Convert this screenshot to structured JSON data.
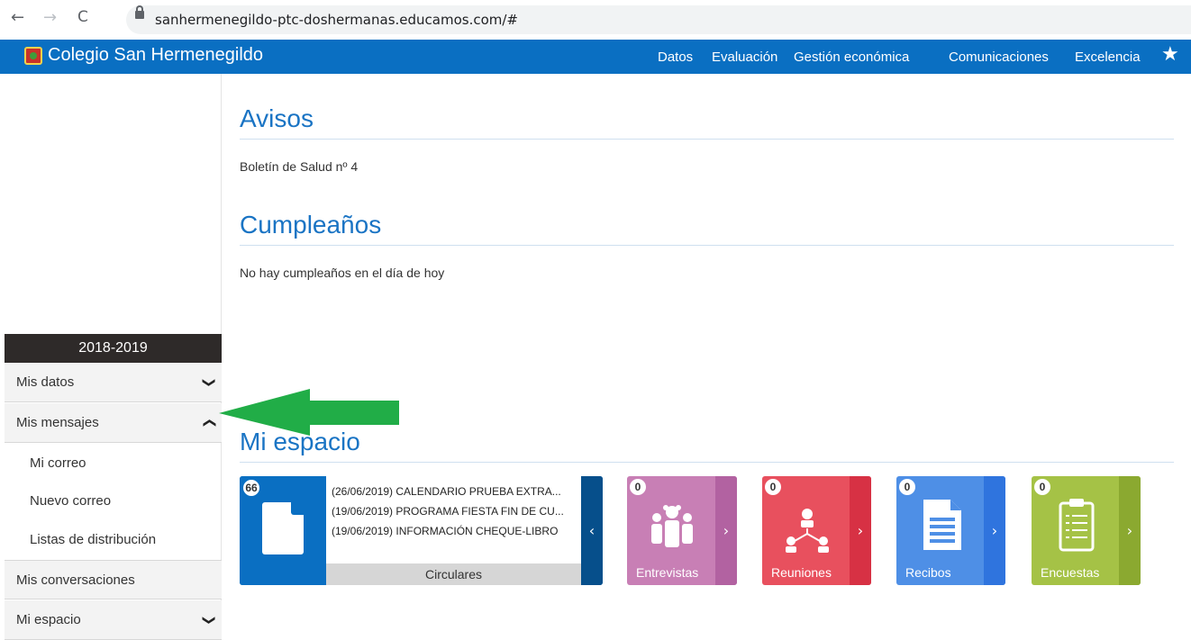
{
  "browser": {
    "back": "←",
    "forward": "→",
    "reload": "C",
    "url": "sanhermenegildo-ptc-doshermanas.educamos.com/#"
  },
  "header": {
    "title": "Colegio San Hermenegildo",
    "nav": [
      "Datos",
      "Evaluación",
      "Gestión económica",
      "Comunicaciones",
      "Excelencia"
    ],
    "star": "★",
    "color": "#0a6fc2"
  },
  "sidebar": {
    "year": "2018-2019",
    "items": {
      "mis_datos": "Mis datos",
      "mis_mensajes": "Mis mensajes",
      "mi_correo": "Mi correo",
      "nuevo_correo": "Nuevo correo",
      "listas": "Listas de distribución",
      "mis_conversaciones": "Mis conversaciones",
      "mi_espacio": "Mi espacio"
    },
    "chevron_down": "❯",
    "chevron_up": "❯"
  },
  "main": {
    "avisos_title": "Avisos",
    "avisos_text": "Boletín de Salud nº 4",
    "cumple_title": "Cumpleaños",
    "cumple_text": "No hay cumpleaños en el día de hoy",
    "espacio_title": "Mi espacio"
  },
  "tiles": {
    "circulares": {
      "count": "66",
      "items": [
        "(26/06/2019) CALENDARIO PRUEBA EXTRA...",
        "(19/06/2019) PROGRAMA FIESTA FIN DE CU...",
        "(19/06/2019) INFORMACIÓN CHEQUE-LIBRO"
      ],
      "label": "Circulares",
      "arrow": "‹"
    },
    "entrevistas": {
      "count": "0",
      "label": "Entrevistas",
      "arrow": "›",
      "color": "#c87fb5"
    },
    "reuniones": {
      "count": "0",
      "label": "Reuniones",
      "arrow": "›",
      "color": "#e8505e"
    },
    "recibos": {
      "count": "0",
      "label": "Recibos",
      "arrow": "›",
      "color": "#4e8fe6"
    },
    "encuestas": {
      "count": "0",
      "label": "Encuestas",
      "arrow": "›",
      "color": "#a5c246"
    }
  }
}
